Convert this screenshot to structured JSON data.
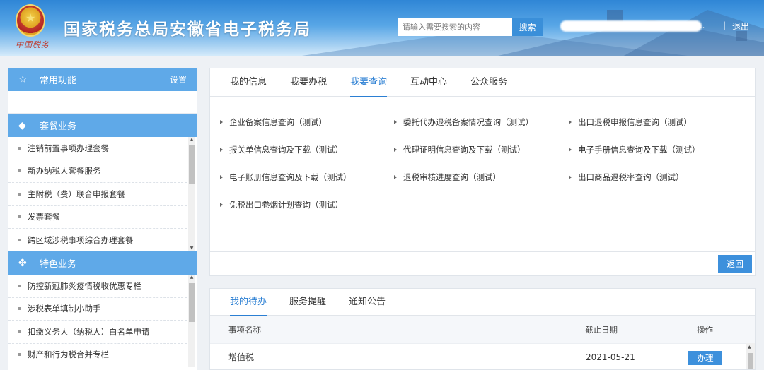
{
  "header": {
    "title": "国家税务总局安徽省电子税务局",
    "signature": "中国税务",
    "search_placeholder": "请输入需要搜索的内容",
    "search_button": "搜索",
    "user_tail": "...",
    "separator": "|",
    "logout": "退出"
  },
  "sidebar": {
    "common": {
      "title": "常用功能",
      "settings": "设置"
    },
    "package": {
      "title": "套餐业务",
      "items": [
        "注销前置事项办理套餐",
        "新办纳税人套餐服务",
        "主附税（费）联合申报套餐",
        "发票套餐",
        "跨区域涉税事项综合办理套餐"
      ]
    },
    "special": {
      "title": "特色业务",
      "items": [
        "防控新冠肺炎疫情税收优惠专栏",
        "涉税表单填制小助手",
        "扣缴义务人（纳税人）白名单申请",
        "财产和行为税合并专栏"
      ]
    }
  },
  "main": {
    "tabs": [
      "我的信息",
      "我要办税",
      "我要查询",
      "互动中心",
      "公众服务"
    ],
    "active_tab": "我要查询",
    "links": [
      "企业备案信息查询（测试）",
      "委托代办退税备案情况查询（测试）",
      "出口退税申报信息查询（测试）",
      "报关单信息查询及下载（测试）",
      "代理证明信息查询及下载（测试）",
      "电子手册信息查询及下载（测试）",
      "电子账册信息查询及下载（测试）",
      "退税审核进度查询（测试）",
      "出口商品退税率查询（测试）",
      "免税出口卷烟计划查询（测试）"
    ],
    "back_button": "返回"
  },
  "todo": {
    "tabs": [
      "我的待办",
      "服务提醒",
      "通知公告"
    ],
    "active_tab": "我的待办",
    "columns": {
      "name": "事项名称",
      "deadline": "截止日期",
      "action": "操作"
    },
    "rows": [
      {
        "name": "增值税",
        "deadline": "2021-05-21",
        "action": "办理"
      }
    ]
  },
  "colors": {
    "header_blue": "#2f86d6",
    "accent": "#2b7fd3",
    "sidebar_head": "#5fa9e8",
    "button": "#3d90dc"
  }
}
